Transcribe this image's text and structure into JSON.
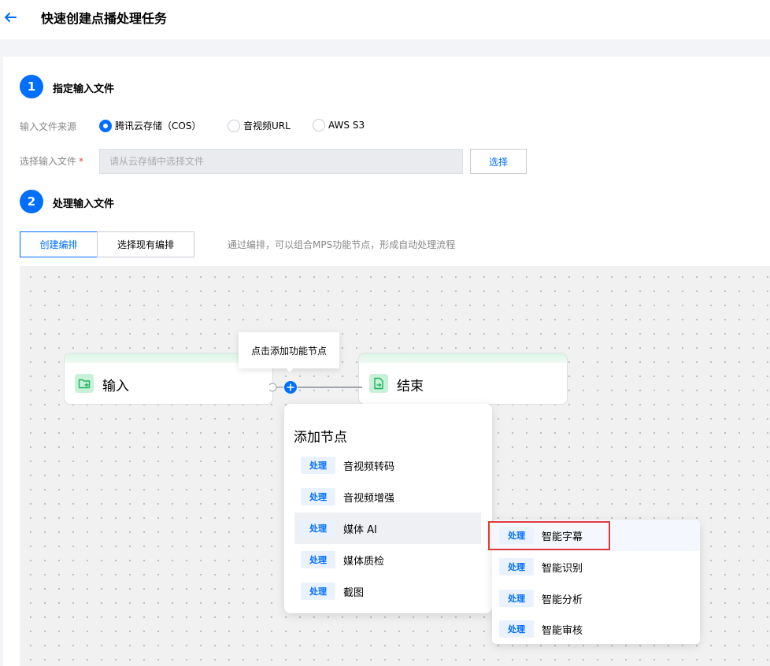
{
  "header": {
    "title": "快速创建点播处理任务",
    "back_icon": "arrow-left-icon"
  },
  "step1": {
    "number": "1",
    "title": "指定输入文件",
    "source_label": "输入文件来源",
    "sources": [
      {
        "label": "腾讯云存储（COS）",
        "checked": true
      },
      {
        "label": "音视频URL",
        "checked": false
      },
      {
        "label": "AWS S3",
        "checked": false
      }
    ],
    "file_label": "选择输入文件",
    "required_mark": "*",
    "file_placeholder": "请从云存储中选择文件",
    "select_button": "选择"
  },
  "step2": {
    "number": "2",
    "title": "处理输入文件",
    "tabs": [
      "创建编排",
      "选择现有编排"
    ],
    "active_tab": 0,
    "hint": "通过编排，可以组合MPS功能节点，形成自动处理流程"
  },
  "canvas": {
    "input_node": {
      "label": "输入",
      "icon": "folder-add-icon"
    },
    "end_node": {
      "label": "结束",
      "icon": "file-export-icon"
    },
    "tooltip": "点击添加功能节点",
    "add_menu": {
      "title": "添加节点",
      "items": [
        {
          "tag": "处理",
          "label": "音视频转码"
        },
        {
          "tag": "处理",
          "label": "音视频增强"
        },
        {
          "tag": "处理",
          "label": "媒体 AI"
        },
        {
          "tag": "处理",
          "label": "媒体质检"
        },
        {
          "tag": "处理",
          "label": "截图"
        }
      ],
      "highlighted_index": 2
    },
    "submenu": {
      "items": [
        {
          "tag": "处理",
          "label": "智能字幕"
        },
        {
          "tag": "处理",
          "label": "智能识别"
        },
        {
          "tag": "处理",
          "label": "智能分析"
        },
        {
          "tag": "处理",
          "label": "智能审核"
        }
      ],
      "hovered_index": 0
    }
  },
  "colors": {
    "primary": "#006eff",
    "highlight_box": "#e03a3a",
    "node_accent": "#c9f0d8"
  }
}
